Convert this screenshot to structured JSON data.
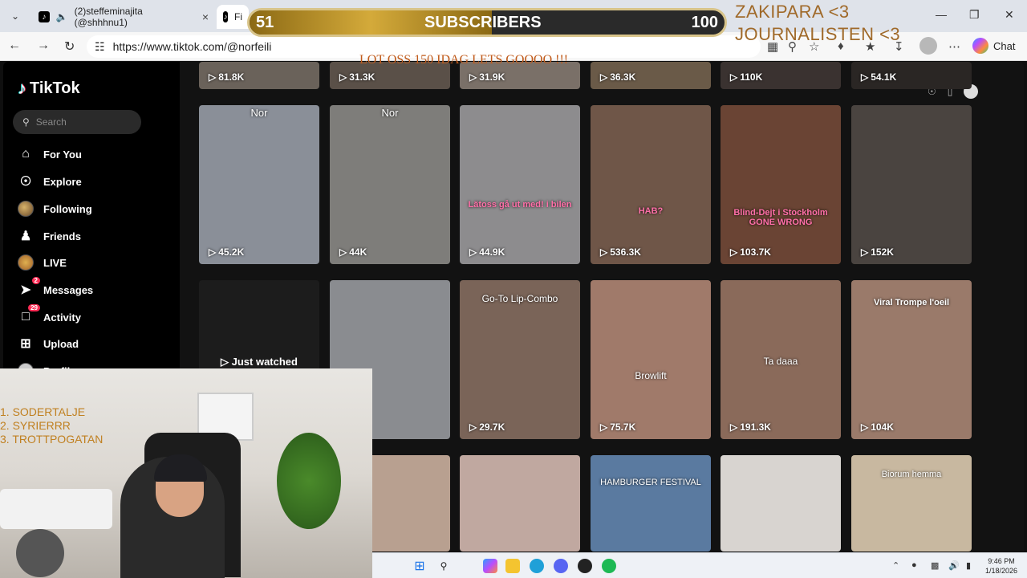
{
  "browser": {
    "tabs": [
      {
        "label": "(2)steffeminajita (@shhhnu1)"
      },
      {
        "label": "Fi"
      }
    ],
    "url": "https://www.tiktok.com/@norfeili",
    "chat_label": "Chat"
  },
  "overlay": {
    "sub_current": "51",
    "sub_label": "SUBSCRIBERS",
    "sub_goal": "100",
    "sub_progress": 0.51,
    "goal_line1": "ZAKIPARA <3",
    "goal_line2": "JOURNALISTEN <3",
    "ticker": "LOT OSS 150 IDAG LETS GOOOO !!!"
  },
  "sidebar": {
    "logo": "TikTok",
    "search_placeholder": "Search",
    "items": [
      {
        "label": "For You",
        "icon": "home-icon"
      },
      {
        "label": "Explore",
        "icon": "compass-icon"
      },
      {
        "label": "Following",
        "icon": "avatar-icon"
      },
      {
        "label": "Friends",
        "icon": "friends-icon"
      },
      {
        "label": "LIVE",
        "icon": "live-avatar-icon"
      },
      {
        "label": "Messages",
        "icon": "send-icon",
        "badge": "2"
      },
      {
        "label": "Activity",
        "icon": "message-icon",
        "badge": "29"
      },
      {
        "label": "Upload",
        "icon": "plus-square-icon"
      },
      {
        "label": "Profile",
        "icon": "profile-icon"
      }
    ]
  },
  "videos_row0": [
    {
      "views": "81.8K"
    },
    {
      "views": "31.3K"
    },
    {
      "views": "31.9K"
    },
    {
      "views": "36.3K"
    },
    {
      "views": "110K"
    },
    {
      "views": "54.1K"
    }
  ],
  "videos_row1": [
    {
      "views": "45.2K",
      "caption": "Nor",
      "color": "#8a8f98"
    },
    {
      "views": "44K",
      "caption": "Nor",
      "color": "#7e7d7a"
    },
    {
      "views": "44.9K",
      "caption": "Lätoss gå ut med! i bilen",
      "color": "#8d8c8e"
    },
    {
      "views": "536.3K",
      "caption": "HAB?",
      "color": "#6f5648"
    },
    {
      "views": "103.7K",
      "caption": "Blind-Dejt i Stockholm GONE WRONG",
      "color": "#6a4434"
    },
    {
      "views": "152K",
      "caption": "",
      "color": "#4a4440"
    }
  ],
  "videos_row2": [
    {
      "views": "",
      "caption": "Just watched",
      "color": "#1c1c1c"
    },
    {
      "views": "",
      "caption": "",
      "color": "#8a8c90"
    },
    {
      "views": "29.7K",
      "caption": "Go-To Lip-Combo",
      "color": "#7a6458"
    },
    {
      "views": "75.7K",
      "caption": "Browlift",
      "color": "#a07a6a"
    },
    {
      "views": "191.3K",
      "caption": "Ta daaa",
      "color": "#8a6a5a"
    },
    {
      "views": "104K",
      "caption": "Viral Trompe l'oeil",
      "color": "#9a7a6a"
    }
  ],
  "videos_row3": [
    {
      "caption": "",
      "color": "#b8a090"
    },
    {
      "caption": "",
      "color": "#c0a8a0"
    },
    {
      "caption": "HAMBURGER FESTIVAL",
      "color": "#5a7aa0"
    },
    {
      "caption": "",
      "color": "#d8d4d0"
    },
    {
      "caption": "Biorum hemma",
      "color": "#c8b8a0"
    }
  ],
  "webcam": {
    "list": [
      "1. SODERTALJE",
      "2. SYRIERRR",
      "3. TROTTPOGATAN"
    ]
  },
  "taskbar": {
    "time": "9:46 PM",
    "date": "1/18/2026"
  }
}
